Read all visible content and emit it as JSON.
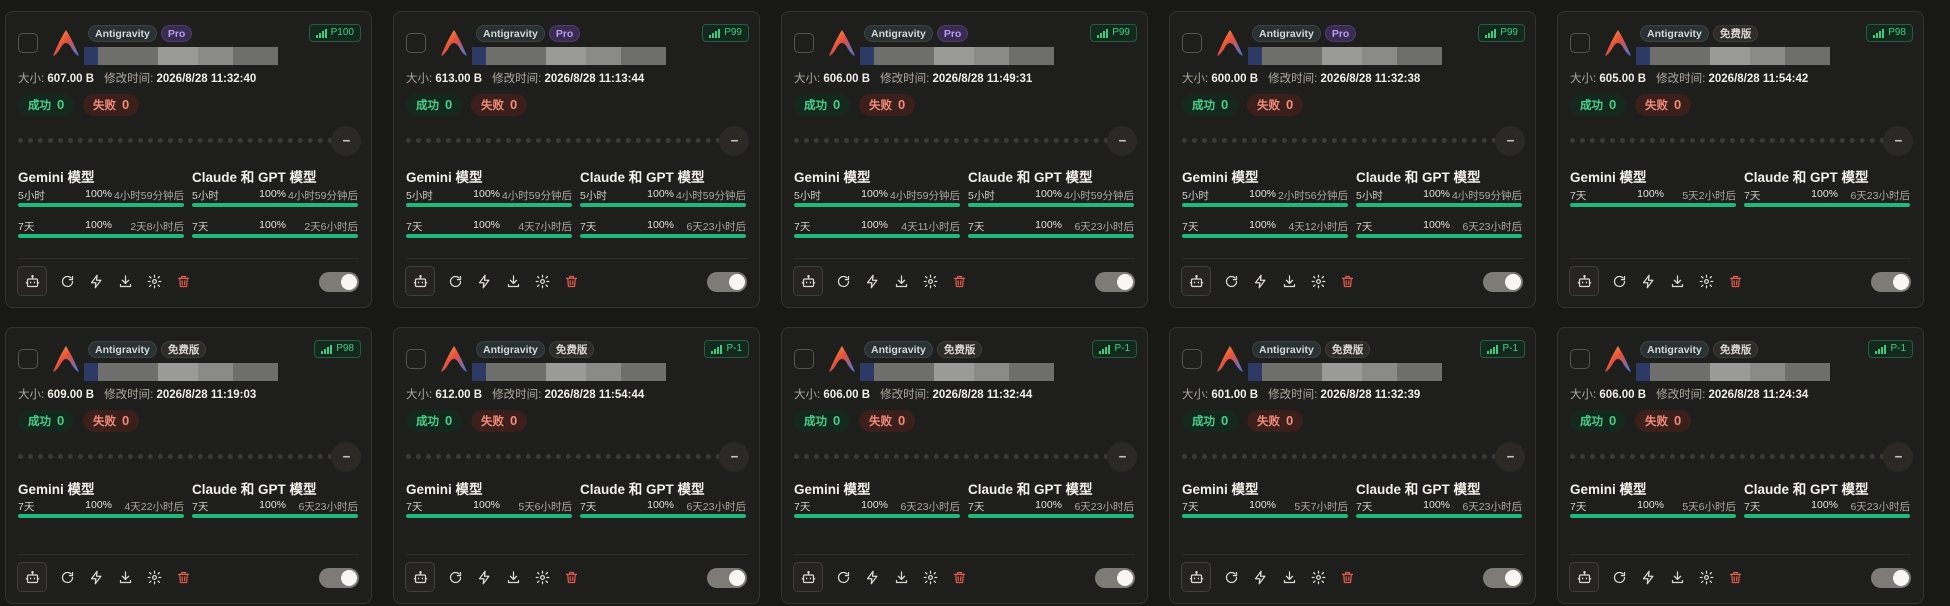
{
  "labels": {
    "size_label": "大小:",
    "modified_label": "修改时间:",
    "success_label": "成功",
    "fail_label": "失败",
    "gemini_title": "Gemini 模型",
    "claude_title": "Claude 和 GPT 模型",
    "more_label": "--"
  },
  "colors": {
    "success": "#49d08a",
    "fail": "#f08a7a",
    "quota_bar": "#1fb97a",
    "pro_badge": "#b79cf0",
    "priority_tag": "#3ecf7e"
  },
  "icons": [
    "bot-icon",
    "refresh-icon",
    "zap-icon",
    "download-icon",
    "settings-icon",
    "trash-icon"
  ],
  "cards": [
    {
      "app": "Antigravity",
      "tier": "Pro",
      "priority": "P100",
      "size": "607.00 B",
      "modified": "2026/8/28 11:32:40",
      "success": "0",
      "fail": "0",
      "gemini": [
        {
          "name": "5小时",
          "pct": "100%",
          "reset": "4小时59分钟后"
        },
        {
          "name": "7天",
          "pct": "100%",
          "reset": "2天8小时后"
        }
      ],
      "claude": [
        {
          "name": "5小时",
          "pct": "100%",
          "reset": "4小时59分钟后"
        },
        {
          "name": "7天",
          "pct": "100%",
          "reset": "2天6小时后"
        }
      ],
      "enabled": true
    },
    {
      "app": "Antigravity",
      "tier": "Pro",
      "priority": "P99",
      "size": "613.00 B",
      "modified": "2026/8/28 11:13:44",
      "success": "0",
      "fail": "0",
      "gemini": [
        {
          "name": "5小时",
          "pct": "100%",
          "reset": "4小时59分钟后"
        },
        {
          "name": "7天",
          "pct": "100%",
          "reset": "4天7小时后"
        }
      ],
      "claude": [
        {
          "name": "5小时",
          "pct": "100%",
          "reset": "4小时59分钟后"
        },
        {
          "name": "7天",
          "pct": "100%",
          "reset": "6天23小时后"
        }
      ],
      "enabled": true
    },
    {
      "app": "Antigravity",
      "tier": "Pro",
      "priority": "P99",
      "size": "606.00 B",
      "modified": "2026/8/28 11:49:31",
      "success": "0",
      "fail": "0",
      "gemini": [
        {
          "name": "5小时",
          "pct": "100%",
          "reset": "4小时59分钟后"
        },
        {
          "name": "7天",
          "pct": "100%",
          "reset": "4天11小时后"
        }
      ],
      "claude": [
        {
          "name": "5小时",
          "pct": "100%",
          "reset": "4小时59分钟后"
        },
        {
          "name": "7天",
          "pct": "100%",
          "reset": "6天23小时后"
        }
      ],
      "enabled": true
    },
    {
      "app": "Antigravity",
      "tier": "Pro",
      "priority": "P99",
      "size": "600.00 B",
      "modified": "2026/8/28 11:32:38",
      "success": "0",
      "fail": "0",
      "gemini": [
        {
          "name": "5小时",
          "pct": "100%",
          "reset": "2小时56分钟后"
        },
        {
          "name": "7天",
          "pct": "100%",
          "reset": "4天12小时后"
        }
      ],
      "claude": [
        {
          "name": "5小时",
          "pct": "100%",
          "reset": "4小时59分钟后"
        },
        {
          "name": "7天",
          "pct": "100%",
          "reset": "6天23小时后"
        }
      ],
      "enabled": true
    },
    {
      "app": "Antigravity",
      "tier": "免费版",
      "priority": "P98",
      "size": "605.00 B",
      "modified": "2026/8/28 11:54:42",
      "success": "0",
      "fail": "0",
      "gemini": [
        {
          "name": "7天",
          "pct": "100%",
          "reset": "5天2小时后"
        }
      ],
      "claude": [
        {
          "name": "7天",
          "pct": "100%",
          "reset": "6天23小时后"
        }
      ],
      "enabled": true
    },
    {
      "app": "Antigravity",
      "tier": "免费版",
      "priority": "P98",
      "size": "609.00 B",
      "modified": "2026/8/28 11:19:03",
      "success": "0",
      "fail": "0",
      "gemini": [
        {
          "name": "7天",
          "pct": "100%",
          "reset": "4天22小时后"
        }
      ],
      "claude": [
        {
          "name": "7天",
          "pct": "100%",
          "reset": "6天23小时后"
        }
      ],
      "enabled": true
    },
    {
      "app": "Antigravity",
      "tier": "免费版",
      "priority": "P-1",
      "size": "612.00 B",
      "modified": "2026/8/28 11:54:44",
      "success": "0",
      "fail": "0",
      "gemini": [
        {
          "name": "7天",
          "pct": "100%",
          "reset": "5天6小时后"
        }
      ],
      "claude": [
        {
          "name": "7天",
          "pct": "100%",
          "reset": "6天23小时后"
        }
      ],
      "enabled": true
    },
    {
      "app": "Antigravity",
      "tier": "免费版",
      "priority": "P-1",
      "size": "606.00 B",
      "modified": "2026/8/28 11:32:44",
      "success": "0",
      "fail": "0",
      "gemini": [
        {
          "name": "7天",
          "pct": "100%",
          "reset": "6天23小时后"
        }
      ],
      "claude": [
        {
          "name": "7天",
          "pct": "100%",
          "reset": "6天23小时后"
        }
      ],
      "enabled": true
    },
    {
      "app": "Antigravity",
      "tier": "免费版",
      "priority": "P-1",
      "size": "601.00 B",
      "modified": "2026/8/28 11:32:39",
      "success": "0",
      "fail": "0",
      "gemini": [
        {
          "name": "7天",
          "pct": "100%",
          "reset": "5天7小时后"
        }
      ],
      "claude": [
        {
          "name": "7天",
          "pct": "100%",
          "reset": "6天23小时后"
        }
      ],
      "enabled": true
    },
    {
      "app": "Antigravity",
      "tier": "免费版",
      "priority": "P-1",
      "size": "606.00 B",
      "modified": "2026/8/28 11:24:34",
      "success": "0",
      "fail": "0",
      "gemini": [
        {
          "name": "7天",
          "pct": "100%",
          "reset": "5天6小时后"
        }
      ],
      "claude": [
        {
          "name": "7天",
          "pct": "100%",
          "reset": "6天23小时后"
        }
      ],
      "enabled": true
    }
  ]
}
